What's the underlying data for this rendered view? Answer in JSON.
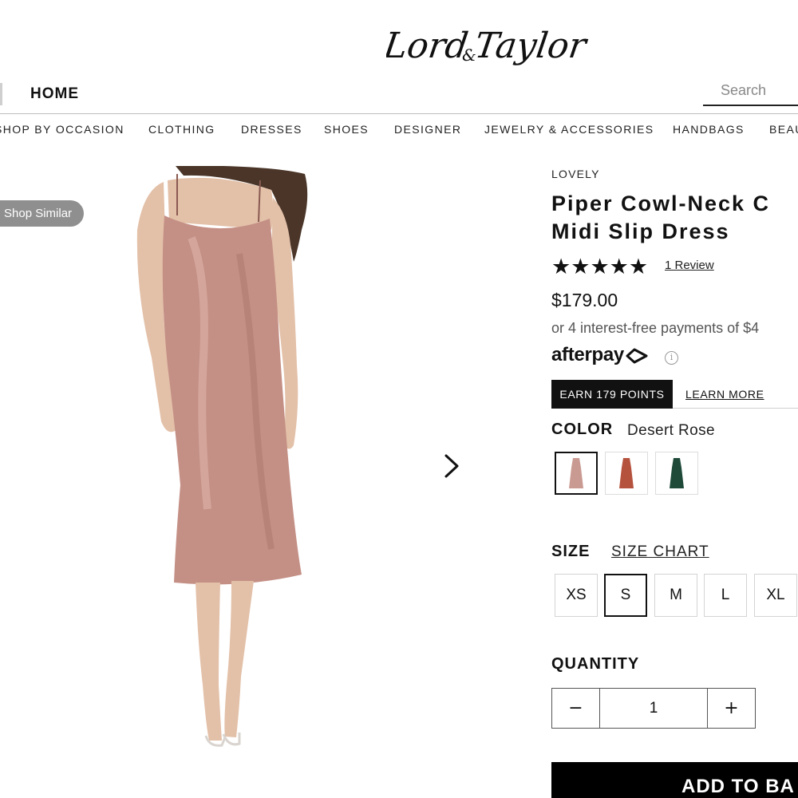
{
  "header": {
    "logo_text": "Lord & Taylor",
    "home_label": "HOME",
    "search_placeholder": "Search"
  },
  "nav": {
    "items": [
      "SHOP BY OCCASION",
      "CLOTHING",
      "DRESSES",
      "SHOES",
      "DESIGNER",
      "JEWELRY & ACCESSORIES",
      "HANDBAGS",
      "BEAU"
    ]
  },
  "gallery": {
    "shop_similar_label": "Shop Similar",
    "next_icon": "chevron-right-icon"
  },
  "product": {
    "brand": "LOVELY",
    "title_line1": "Piper Cowl-Neck C",
    "title_line2": "Midi Slip Dress",
    "rating": 5,
    "rating_max": 5,
    "review_link": "1 Review",
    "price": "$179.00",
    "installments": "or 4 interest-free payments of $4",
    "afterpay_label": "afterpay",
    "points_badge": "EARN 179 POINTS",
    "learn_more": "LEARN MORE"
  },
  "color": {
    "label": "COLOR",
    "selected": "Desert Rose",
    "swatches": [
      {
        "name": "Desert Rose",
        "hex": "#c99a92",
        "selected": true
      },
      {
        "name": "Rust",
        "hex": "#b5523e",
        "selected": false
      },
      {
        "name": "Emerald",
        "hex": "#1f4a3a",
        "selected": false
      }
    ]
  },
  "size": {
    "label": "SIZE",
    "chart_link": "SIZE CHART",
    "options": [
      "XS",
      "S",
      "M",
      "L",
      "XL"
    ],
    "selected": "S"
  },
  "quantity": {
    "label": "QUANTITY",
    "minus": "−",
    "value": "1",
    "plus": "+"
  },
  "cta": {
    "add_to_bag": "ADD TO BA"
  },
  "colors": {
    "dress": "#c48f85",
    "skin": "#e3c0a8",
    "hair": "#4a3528",
    "black": "#000000"
  }
}
